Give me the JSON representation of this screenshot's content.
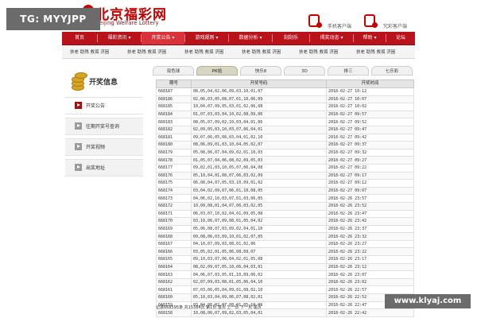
{
  "overlay": {
    "tg_badge": "TG: MYYJPP",
    "watermark": "www.klyaj.com"
  },
  "header": {
    "logo_cn": "北京福彩网",
    "logo_en": "Beijing Welfare Lottery",
    "mobile_client": "手机客户端",
    "gold_client": "究彩客户端"
  },
  "nav": [
    {
      "label": "首页",
      "active": false
    },
    {
      "label": "福彩资讯 ▾",
      "active": false
    },
    {
      "label": "开奖公告 ▾",
      "active": true
    },
    {
      "label": "游戏规则 ▾",
      "active": false
    },
    {
      "label": "数据分析 ▾",
      "active": false
    },
    {
      "label": "刮刮乐",
      "active": false
    },
    {
      "label": "揭奖动态 ▾",
      "active": false
    },
    {
      "label": "帮助 ▾",
      "active": false
    },
    {
      "label": "论坛",
      "active": false
    }
  ],
  "subnav": [
    "扶老 助残 救孤 济困",
    "扶老 助残 救孤 济困",
    "扶老 助残 救孤 济困",
    "扶老 助残 救孤 济困",
    "扶老 助残 救孤 济困",
    "扶老 助残 救孤 济困"
  ],
  "sidebar": {
    "title": "开奖信息",
    "items": [
      {
        "label": "开奖公告",
        "active": true
      },
      {
        "label": "往期开奖号查询",
        "active": false
      },
      {
        "label": "开奖视频",
        "active": false
      },
      {
        "label": "出奖地址",
        "active": false
      }
    ]
  },
  "tabs": [
    {
      "label": "双色球",
      "active": false
    },
    {
      "label": "PK拾",
      "active": true
    },
    {
      "label": "快乐8",
      "active": false
    },
    {
      "label": "3D",
      "active": false
    },
    {
      "label": "排三",
      "active": false
    },
    {
      "label": "七乐彩",
      "active": false
    }
  ],
  "table": {
    "headers": [
      "期号",
      "开奖号码",
      "开奖时间"
    ],
    "rows": [
      [
        "668187",
        "08,05,04,02,06,09,03,10,01,07",
        "2018-02-27 10:12"
      ],
      [
        "668186",
        "02,06,03,05,08,07,01,10,06,09",
        "2018-02-27 10:07"
      ],
      [
        "668185",
        "10,04,07,09,05,03,01,02,06,08",
        "2018-02-27 10:02"
      ],
      [
        "668184",
        "01,07,03,03,04,10,02,08,09,06",
        "2018-02-27 09:57"
      ],
      [
        "668183",
        "08,05,07,09,02,10,03,04,01,06",
        "2018-02-27 09:52"
      ],
      [
        "668182",
        "02,09,05,03,10,03,07,06,04,01",
        "2018-02-27 09:47"
      ],
      [
        "668181",
        "09,07,06,05,08,03,04,01,02,10",
        "2018-02-27 09:42"
      ],
      [
        "668180",
        "08,06,09,01,03,10,04,05,02,07",
        "2018-02-27 09:37"
      ],
      [
        "668179",
        "05,08,06,07,04,09,02,01,10,03",
        "2018-02-27 09:32"
      ],
      [
        "668178",
        "01,05,07,04,06,08,02,09,05,03",
        "2018-02-27 09:27"
      ],
      [
        "668177",
        "09,02,01,03,10,05,07,06,04,08",
        "2018-02-27 09:22"
      ],
      [
        "668176",
        "05,10,04,01,08,07,06,03,02,09",
        "2018-02-27 09:17"
      ],
      [
        "668175",
        "06,08,04,07,05,03,10,09,01,02",
        "2018-02-27 09:12"
      ],
      [
        "668174",
        "03,04,02,09,07,06,01,10,08,05",
        "2018-02-27 09:07"
      ],
      [
        "668173",
        "04,06,02,10,03,07,01,03,06,05",
        "2018-02-26 23:57"
      ],
      [
        "668172",
        "10,09,08,01,04,07,06,03,02,05",
        "2018-02-26 23:52"
      ],
      [
        "668171",
        "06,03,07,10,02,04,01,09,05,08",
        "2018-02-26 23:47"
      ],
      [
        "668170",
        "03,10,06,07,09,08,01,05,04,02",
        "2018-02-26 23:42"
      ],
      [
        "668169",
        "05,06,08,07,03,09,02,04,01,10",
        "2018-02-26 23:37"
      ],
      [
        "668168",
        "09,08,06,03,09,10,01,02,07,05",
        "2018-02-26 23:32"
      ],
      [
        "668167",
        "04,10,07,09,03,08,01,02,06",
        "2018-02-26 23:27"
      ],
      [
        "668166",
        "03,05,02,01,05,06,08,09,07",
        "2018-02-26 23:22"
      ],
      [
        "668165",
        "09,10,03,07,06,04,02,01,05,08",
        "2018-02-26 23:17"
      ],
      [
        "668164",
        "08,02,09,07,05,10,06,04,03,01",
        "2018-02-26 23:12"
      ],
      [
        "668163",
        "04,06,07,03,05,01,10,09,06,02",
        "2018-02-26 23:07"
      ],
      [
        "668162",
        "02,07,09,03,08,01,05,06,04,10",
        "2018-02-26 23:02"
      ],
      [
        "668161",
        "07,03,06,05,04,09,01,08,02,10",
        "2018-02-26 22:57"
      ],
      [
        "668160",
        "05,10,03,04,09,06,07,08,02,01",
        "2018-02-26 22:52"
      ],
      [
        "668159",
        "03,04,06,02,07,08,01,05,10,09",
        "2018-02-26 22:47"
      ],
      [
        "668158",
        "10,08,06,07,09,02,03,05,04,01",
        "2018-02-26 22:42"
      ]
    ]
  },
  "pager": "记录668595条  共15384页 第1页 首页  上一页  下一页  尾页"
}
